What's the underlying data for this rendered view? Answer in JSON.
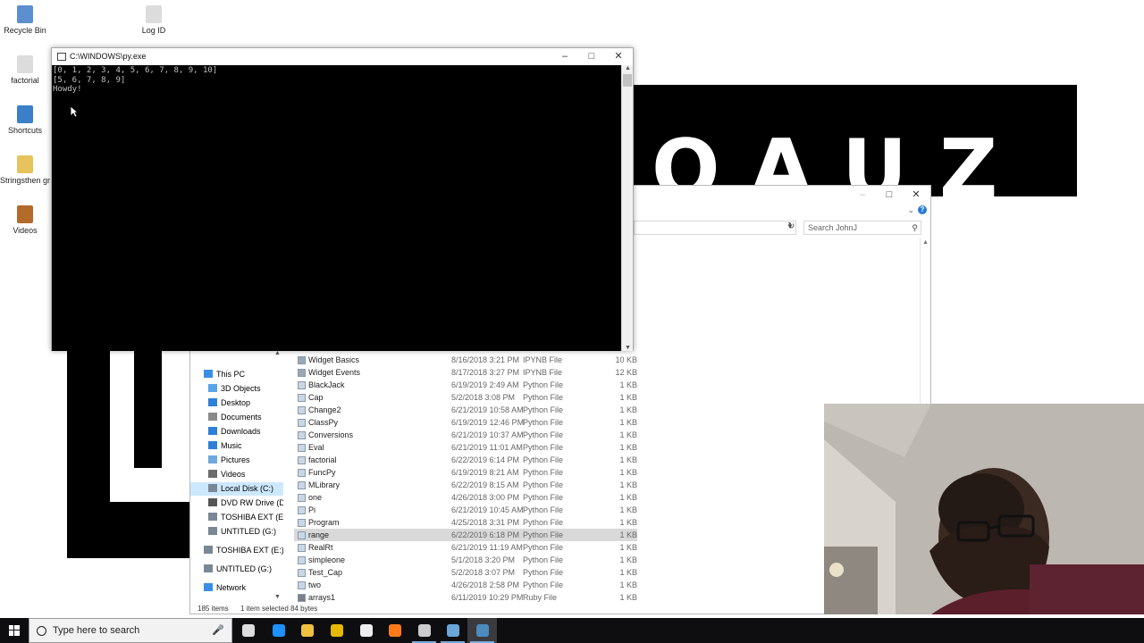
{
  "desktop": {
    "icons": [
      {
        "label": "Recycle Bin",
        "icon": "recycle-bin-icon"
      },
      {
        "label": "Log ID",
        "icon": "document-icon"
      },
      {
        "label": "factorial",
        "icon": "document-icon"
      },
      {
        "label": "Shortcuts",
        "icon": "shortcut-icon"
      },
      {
        "label": "Stringsthen gr",
        "icon": "folder-icon"
      },
      {
        "label": "Videos",
        "icon": "video-icon"
      }
    ]
  },
  "console": {
    "title": "C:\\WINDOWS\\py.exe",
    "output": "[0, 1, 2, 3, 4, 5, 6, 7, 8, 9, 10]\n[5, 6, 7, 8, 9]\nHowdy!"
  },
  "explorer": {
    "search_placeholder": "Search JohnJ",
    "nav": [
      {
        "label": "This PC",
        "icon": "pc-icon",
        "indent": 0
      },
      {
        "label": "3D Objects",
        "icon": "cube-icon",
        "indent": 1
      },
      {
        "label": "Desktop",
        "icon": "desktop-icon",
        "indent": 1
      },
      {
        "label": "Documents",
        "icon": "documents-icon",
        "indent": 1
      },
      {
        "label": "Downloads",
        "icon": "download-icon",
        "indent": 1
      },
      {
        "label": "Music",
        "icon": "music-icon",
        "indent": 1
      },
      {
        "label": "Pictures",
        "icon": "pictures-icon",
        "indent": 1
      },
      {
        "label": "Videos",
        "icon": "videos-icon",
        "indent": 1
      },
      {
        "label": "Local Disk (C:)",
        "icon": "drive-icon",
        "indent": 1,
        "selected": true
      },
      {
        "label": "DVD RW Drive (D",
        "icon": "dvd-icon",
        "indent": 1
      },
      {
        "label": "TOSHIBA EXT (E:",
        "icon": "drive-icon",
        "indent": 1
      },
      {
        "label": "UNTITLED (G:)",
        "icon": "drive-icon",
        "indent": 1
      },
      {
        "label": "TOSHIBA EXT (E:)",
        "icon": "drive-icon",
        "indent": 0
      },
      {
        "label": "UNTITLED (G:)",
        "icon": "drive-icon",
        "indent": 0
      },
      {
        "label": "Network",
        "icon": "network-icon",
        "indent": 0
      }
    ],
    "files": [
      {
        "name": "Widget Basics",
        "date": "8/16/2018 3:21 PM",
        "type": "IPYNB File",
        "size": "10 KB"
      },
      {
        "name": "Widget Events",
        "date": "8/17/2018 3:27 PM",
        "type": "IPYNB File",
        "size": "12 KB"
      },
      {
        "name": "BlackJack",
        "date": "6/19/2019 2:49 AM",
        "type": "Python File",
        "size": "1 KB"
      },
      {
        "name": "Cap",
        "date": "5/2/2018 3:08 PM",
        "type": "Python File",
        "size": "1 KB"
      },
      {
        "name": "Change2",
        "date": "6/21/2019 10:58 AM",
        "type": "Python File",
        "size": "1 KB"
      },
      {
        "name": "ClassPy",
        "date": "6/19/2019 12:46 PM",
        "type": "Python File",
        "size": "1 KB"
      },
      {
        "name": "Conversions",
        "date": "6/21/2019 10:37 AM",
        "type": "Python File",
        "size": "1 KB"
      },
      {
        "name": "Eval",
        "date": "6/21/2019 11:01 AM",
        "type": "Python File",
        "size": "1 KB"
      },
      {
        "name": "factorial",
        "date": "6/22/2019 6:14 PM",
        "type": "Python File",
        "size": "1 KB"
      },
      {
        "name": "FuncPy",
        "date": "6/19/2019 8:21 AM",
        "type": "Python File",
        "size": "1 KB"
      },
      {
        "name": "MLibrary",
        "date": "6/22/2019 8:15 AM",
        "type": "Python File",
        "size": "1 KB"
      },
      {
        "name": "one",
        "date": "4/26/2018 3:00 PM",
        "type": "Python File",
        "size": "1 KB"
      },
      {
        "name": "Pi",
        "date": "6/21/2019 10:45 AM",
        "type": "Python File",
        "size": "1 KB"
      },
      {
        "name": "Program",
        "date": "4/25/2018 3:31 PM",
        "type": "Python File",
        "size": "1 KB"
      },
      {
        "name": "range",
        "date": "6/22/2019 6:18 PM",
        "type": "Python File",
        "size": "1 KB",
        "selected": true
      },
      {
        "name": "RealRt",
        "date": "6/21/2019 11:19 AM",
        "type": "Python File",
        "size": "1 KB"
      },
      {
        "name": "simpleone",
        "date": "5/1/2018 3:20 PM",
        "type": "Python File",
        "size": "1 KB"
      },
      {
        "name": "Test_Cap",
        "date": "5/2/2018 3:07 PM",
        "type": "Python File",
        "size": "1 KB"
      },
      {
        "name": "two",
        "date": "4/26/2018 2:58 PM",
        "type": "Python File",
        "size": "1 KB"
      },
      {
        "name": "arrays1",
        "date": "6/11/2019 10:29 PM",
        "type": "Ruby File",
        "size": "1 KB"
      }
    ],
    "status": {
      "count": "185 items",
      "selection": "1 item selected  84 bytes"
    }
  },
  "taskbar": {
    "search_placeholder": "Type here to search",
    "apps": [
      {
        "icon": "task-view-icon"
      },
      {
        "icon": "edge-icon"
      },
      {
        "icon": "file-explorer-icon"
      },
      {
        "icon": "store-icon"
      },
      {
        "icon": "mail-icon"
      },
      {
        "icon": "firefox-icon"
      },
      {
        "icon": "settings-icon"
      },
      {
        "icon": "python-idle-icon"
      },
      {
        "icon": "python-console-icon"
      }
    ]
  },
  "colors": {
    "accent": "#0078d7",
    "console_bg": "#000000",
    "console_fg": "#c0c0c0",
    "selection": "#cce8ff"
  }
}
